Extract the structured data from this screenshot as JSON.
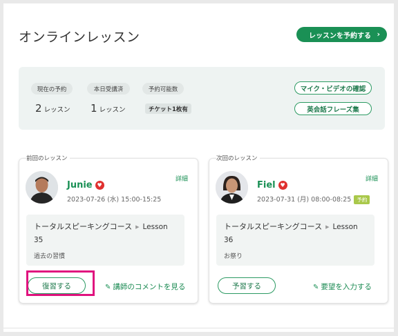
{
  "header": {
    "title": "オンラインレッスン",
    "book_button": "レッスンを予約する",
    "book_chevron": "›"
  },
  "summary": {
    "stats": [
      {
        "label": "現在の予約",
        "value": "2",
        "unit": "レッスン"
      },
      {
        "label": "本日受講済",
        "value": "1",
        "unit": "レッスン"
      },
      {
        "label": "予約可能数",
        "badge": "チケット1枚有"
      }
    ],
    "buttons": [
      "マイク・ビデオの確認",
      "英会話フレーズ集"
    ]
  },
  "previous": {
    "section_label": "前回のレッスン",
    "teacher": "Junie",
    "date": "2023-07-26 (水) 15:00-15:25",
    "detail": "詳細",
    "course": "トータルスピーキングコース",
    "lesson_word": "Lesson",
    "lesson_num": "35",
    "topic": "過去の習慣",
    "button": "復習する",
    "link": "講師のコメントを見る"
  },
  "next": {
    "section_label": "次回のレッスン",
    "teacher": "Fiel",
    "date": "2023-07-31 (月) 08:00-08:25",
    "status": "予約",
    "detail": "詳細",
    "course": "トータルスピーキングコース",
    "lesson_word": "Lesson",
    "lesson_num": "36",
    "topic": "お祭り",
    "button": "予習する",
    "link": "要望を入力する"
  },
  "colors": {
    "accent": "#1a9055",
    "highlight": "#e0127e",
    "heart": "#e0312f",
    "status_badge": "#a9c84a"
  },
  "icons": {
    "heart": "heart-icon",
    "pencil": "pencil-icon",
    "chevron": "chevron-right-icon",
    "arrow": "triangle-right-icon"
  }
}
